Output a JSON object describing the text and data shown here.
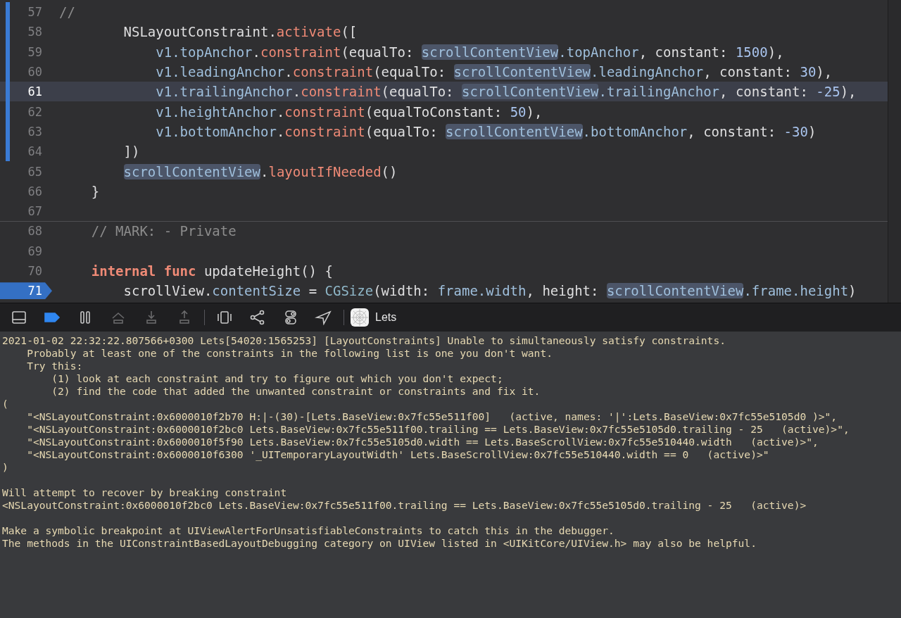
{
  "editor": {
    "lines": [
      {
        "number": "57",
        "changed": true,
        "current": false,
        "breakpoint": false,
        "divider_above": false,
        "tokens": [
          {
            "kind": "comment",
            "text": "//"
          }
        ]
      },
      {
        "number": "58",
        "changed": true,
        "current": false,
        "breakpoint": false,
        "divider_above": false,
        "tokens": [
          {
            "kind": "plain",
            "text": "        NSLayoutConstraint."
          },
          {
            "kind": "method",
            "text": "activate"
          },
          {
            "kind": "plain",
            "text": "(["
          }
        ]
      },
      {
        "number": "59",
        "changed": true,
        "current": false,
        "breakpoint": false,
        "divider_above": false,
        "tokens": [
          {
            "kind": "property",
            "text": "            v1."
          },
          {
            "kind": "property",
            "text": "topAnchor"
          },
          {
            "kind": "plain",
            "text": "."
          },
          {
            "kind": "method",
            "text": "constraint"
          },
          {
            "kind": "plain",
            "text": "(equalTo: "
          },
          {
            "kind": "highlight",
            "text": "scrollContentView"
          },
          {
            "kind": "property",
            "text": ".topAnchor"
          },
          {
            "kind": "plain",
            "text": ", constant: "
          },
          {
            "kind": "number",
            "text": "1500"
          },
          {
            "kind": "plain",
            "text": "),"
          }
        ]
      },
      {
        "number": "60",
        "changed": true,
        "current": false,
        "breakpoint": false,
        "divider_above": false,
        "tokens": [
          {
            "kind": "property",
            "text": "            v1."
          },
          {
            "kind": "property",
            "text": "leadingAnchor"
          },
          {
            "kind": "plain",
            "text": "."
          },
          {
            "kind": "method",
            "text": "constraint"
          },
          {
            "kind": "plain",
            "text": "(equalTo: "
          },
          {
            "kind": "highlight",
            "text": "scrollContentView"
          },
          {
            "kind": "property",
            "text": ".leadingAnchor"
          },
          {
            "kind": "plain",
            "text": ", constant: "
          },
          {
            "kind": "number",
            "text": "30"
          },
          {
            "kind": "plain",
            "text": "),"
          }
        ]
      },
      {
        "number": "61",
        "changed": true,
        "current": true,
        "breakpoint": false,
        "divider_above": false,
        "tokens": [
          {
            "kind": "property",
            "text": "            v1."
          },
          {
            "kind": "property",
            "text": "trailingAnchor"
          },
          {
            "kind": "plain",
            "text": "."
          },
          {
            "kind": "method",
            "text": "constraint"
          },
          {
            "kind": "plain",
            "text": "(equalTo: "
          },
          {
            "kind": "highlight",
            "text": "scrollContentView"
          },
          {
            "kind": "property",
            "text": ".trailingAnchor"
          },
          {
            "kind": "plain",
            "text": ", constant: "
          },
          {
            "kind": "number",
            "text": "-25"
          },
          {
            "kind": "plain",
            "text": "),"
          }
        ]
      },
      {
        "number": "62",
        "changed": true,
        "current": false,
        "breakpoint": false,
        "divider_above": false,
        "tokens": [
          {
            "kind": "property",
            "text": "            v1."
          },
          {
            "kind": "property",
            "text": "heightAnchor"
          },
          {
            "kind": "plain",
            "text": "."
          },
          {
            "kind": "method",
            "text": "constraint"
          },
          {
            "kind": "plain",
            "text": "(equalToConstant: "
          },
          {
            "kind": "number",
            "text": "50"
          },
          {
            "kind": "plain",
            "text": "),"
          }
        ]
      },
      {
        "number": "63",
        "changed": true,
        "current": false,
        "breakpoint": false,
        "divider_above": false,
        "tokens": [
          {
            "kind": "property",
            "text": "            v1."
          },
          {
            "kind": "property",
            "text": "bottomAnchor"
          },
          {
            "kind": "plain",
            "text": "."
          },
          {
            "kind": "method",
            "text": "constraint"
          },
          {
            "kind": "plain",
            "text": "(equalTo: "
          },
          {
            "kind": "highlight",
            "text": "scrollContentView"
          },
          {
            "kind": "property",
            "text": ".bottomAnchor"
          },
          {
            "kind": "plain",
            "text": ", constant: "
          },
          {
            "kind": "number",
            "text": "-30"
          },
          {
            "kind": "plain",
            "text": ")"
          }
        ]
      },
      {
        "number": "64",
        "changed": true,
        "current": false,
        "breakpoint": false,
        "divider_above": false,
        "tokens": [
          {
            "kind": "plain",
            "text": "        ])"
          }
        ]
      },
      {
        "number": "65",
        "changed": false,
        "current": false,
        "breakpoint": false,
        "divider_above": false,
        "tokens": [
          {
            "kind": "highlight",
            "text": "        scrollContentView"
          },
          {
            "kind": "method",
            "text": ".layoutIfNeeded"
          },
          {
            "kind": "plain",
            "text": "()"
          }
        ]
      },
      {
        "number": "66",
        "changed": false,
        "current": false,
        "breakpoint": false,
        "divider_above": false,
        "tokens": [
          {
            "kind": "plain",
            "text": "    }"
          }
        ]
      },
      {
        "number": "67",
        "changed": false,
        "current": false,
        "breakpoint": false,
        "divider_above": false
      },
      {
        "number": "68",
        "changed": false,
        "current": false,
        "breakpoint": false,
        "divider_above": true,
        "tokens": [
          {
            "kind": "comment",
            "text": "    // MARK: - Private"
          }
        ]
      },
      {
        "number": "69",
        "changed": false,
        "current": false,
        "breakpoint": false,
        "divider_above": false
      },
      {
        "number": "70",
        "changed": false,
        "current": false,
        "breakpoint": false,
        "divider_above": false,
        "tokens": [
          {
            "kind": "keyword",
            "text": "    internal func "
          },
          {
            "kind": "plain",
            "text": "updateHeight() {"
          }
        ]
      },
      {
        "number": "71",
        "changed": false,
        "current": false,
        "breakpoint": true,
        "divider_above": false,
        "tokens": [
          {
            "kind": "plain",
            "text": "        scrollView."
          },
          {
            "kind": "property",
            "text": "contentSize"
          },
          {
            "kind": "plain",
            "text": " = "
          },
          {
            "kind": "type",
            "text": "CGSize"
          },
          {
            "kind": "plain",
            "text": "(width: "
          },
          {
            "kind": "property",
            "text": "frame.width"
          },
          {
            "kind": "plain",
            "text": ", height: "
          },
          {
            "kind": "highlight",
            "text": "scrollContentView"
          },
          {
            "kind": "property",
            "text": ".frame.height"
          },
          {
            "kind": "plain",
            "text": ")"
          }
        ]
      }
    ]
  },
  "debug_bar": {
    "buttons": [
      {
        "kind": "panel",
        "disabled": false,
        "selected": false
      },
      {
        "kind": "breakpoints",
        "disabled": false,
        "selected": true
      },
      {
        "kind": "pause",
        "disabled": false,
        "selected": false
      },
      {
        "kind": "step-over",
        "disabled": true,
        "selected": false
      },
      {
        "kind": "step-in",
        "disabled": true,
        "selected": false
      },
      {
        "kind": "step-out",
        "disabled": true,
        "selected": false
      },
      {
        "kind": "view-debugger",
        "disabled": false,
        "selected": false
      },
      {
        "kind": "memory-graph",
        "disabled": false,
        "selected": false
      },
      {
        "kind": "environment",
        "disabled": false,
        "selected": false
      },
      {
        "kind": "location",
        "disabled": false,
        "selected": false
      }
    ],
    "target": "Lets"
  },
  "console": {
    "lines": [
      {
        "text": "2021-01-02 22:32:22.807566+0300 Lets[54020:1565253] [LayoutConstraints] Unable to simultaneously satisfy constraints.",
        "space_before": false
      },
      {
        "text": "    Probably at least one of the constraints in the following list is one you don't want.",
        "space_before": false
      },
      {
        "text": "    Try this:",
        "space_before": false
      },
      {
        "text": "        (1) look at each constraint and try to figure out which you don't expect;",
        "space_before": false
      },
      {
        "text": "        (2) find the code that added the unwanted constraint or constraints and fix it.",
        "space_before": false
      },
      {
        "text": "(",
        "space_before": false
      },
      {
        "text": "    \"<NSLayoutConstraint:0x6000010f2b70 H:|-(30)-[Lets.BaseView:0x7fc55e511f00]   (active, names: '|':Lets.BaseView:0x7fc55e5105d0 )>\",",
        "space_before": false
      },
      {
        "text": "    \"<NSLayoutConstraint:0x6000010f2bc0 Lets.BaseView:0x7fc55e511f00.trailing == Lets.BaseView:0x7fc55e5105d0.trailing - 25   (active)>\",",
        "space_before": false
      },
      {
        "text": "    \"<NSLayoutConstraint:0x6000010f5f90 Lets.BaseView:0x7fc55e5105d0.width == Lets.BaseScrollView:0x7fc55e510440.width   (active)>\",",
        "space_before": false
      },
      {
        "text": "    \"<NSLayoutConstraint:0x6000010f6300 '_UITemporaryLayoutWidth' Lets.BaseScrollView:0x7fc55e510440.width == 0   (active)>\"",
        "space_before": false
      },
      {
        "text": ")",
        "space_before": false
      },
      {
        "text": "Will attempt to recover by breaking constraint",
        "space_before": true
      },
      {
        "text": "<NSLayoutConstraint:0x6000010f2bc0 Lets.BaseView:0x7fc55e511f00.trailing == Lets.BaseView:0x7fc55e5105d0.trailing - 25   (active)>",
        "space_before": false
      },
      {
        "text": "Make a symbolic breakpoint at UIViewAlertForUnsatisfiableConstraints to catch this in the debugger.",
        "space_before": true
      },
      {
        "text": "The methods in the UIConstraintBasedLayoutDebugging category on UIView listed in <UIKitCore/UIView.h> may also be helpful.",
        "space_before": false
      }
    ]
  }
}
